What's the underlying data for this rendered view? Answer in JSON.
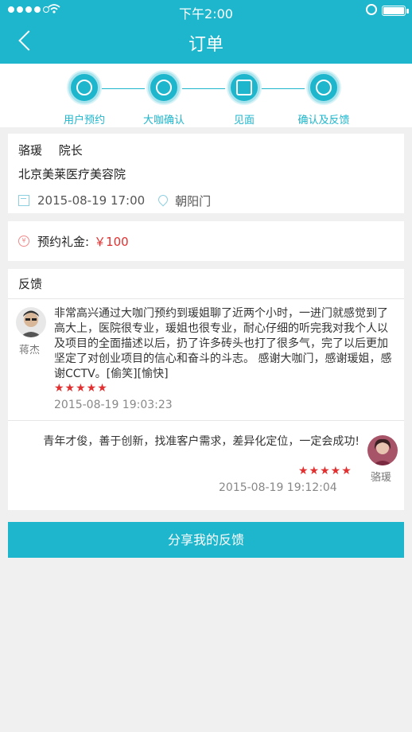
{
  "status_bar": {
    "time": "下午2:00"
  },
  "header": {
    "title": "订单"
  },
  "steps": [
    "用户预约",
    "大咖确认",
    "见面",
    "确认及反馈"
  ],
  "order": {
    "name": "骆瑗",
    "role": "院长",
    "clinic": "北京美莱医疗美容院",
    "datetime": "2015-08-19 17:00",
    "location": "朝阳门"
  },
  "gift": {
    "label": "预约礼金:",
    "amount": "￥100"
  },
  "feedback": {
    "title": "反馈",
    "reviews": [
      {
        "author": "蒋杰",
        "text": "非常高兴通过大咖门预约到瑗姐聊了近两个小时，一进门就感觉到了高大上，医院很专业，瑗姐也很专业，耐心仔细的听完我对我个人以及项目的全面描述以后，扔了许多砖头也打了很多气，完了以后更加坚定了对创业项目的信心和奋斗的斗志。 感谢大咖门，感谢瑗姐，感谢CCTV。[偷笑][愉快]",
        "rating": 5,
        "timestamp": "2015-08-19 19:03:23"
      },
      {
        "author": "骆瑗",
        "text": "青年才俊，善于创新，找准客户需求，差异化定位，一定会成功!",
        "rating": 5,
        "timestamp": "2015-08-19 19:12:04"
      }
    ]
  },
  "share_button": "分享我的反馈",
  "colors": {
    "accent": "#1db6cc",
    "price": "#e23030"
  }
}
